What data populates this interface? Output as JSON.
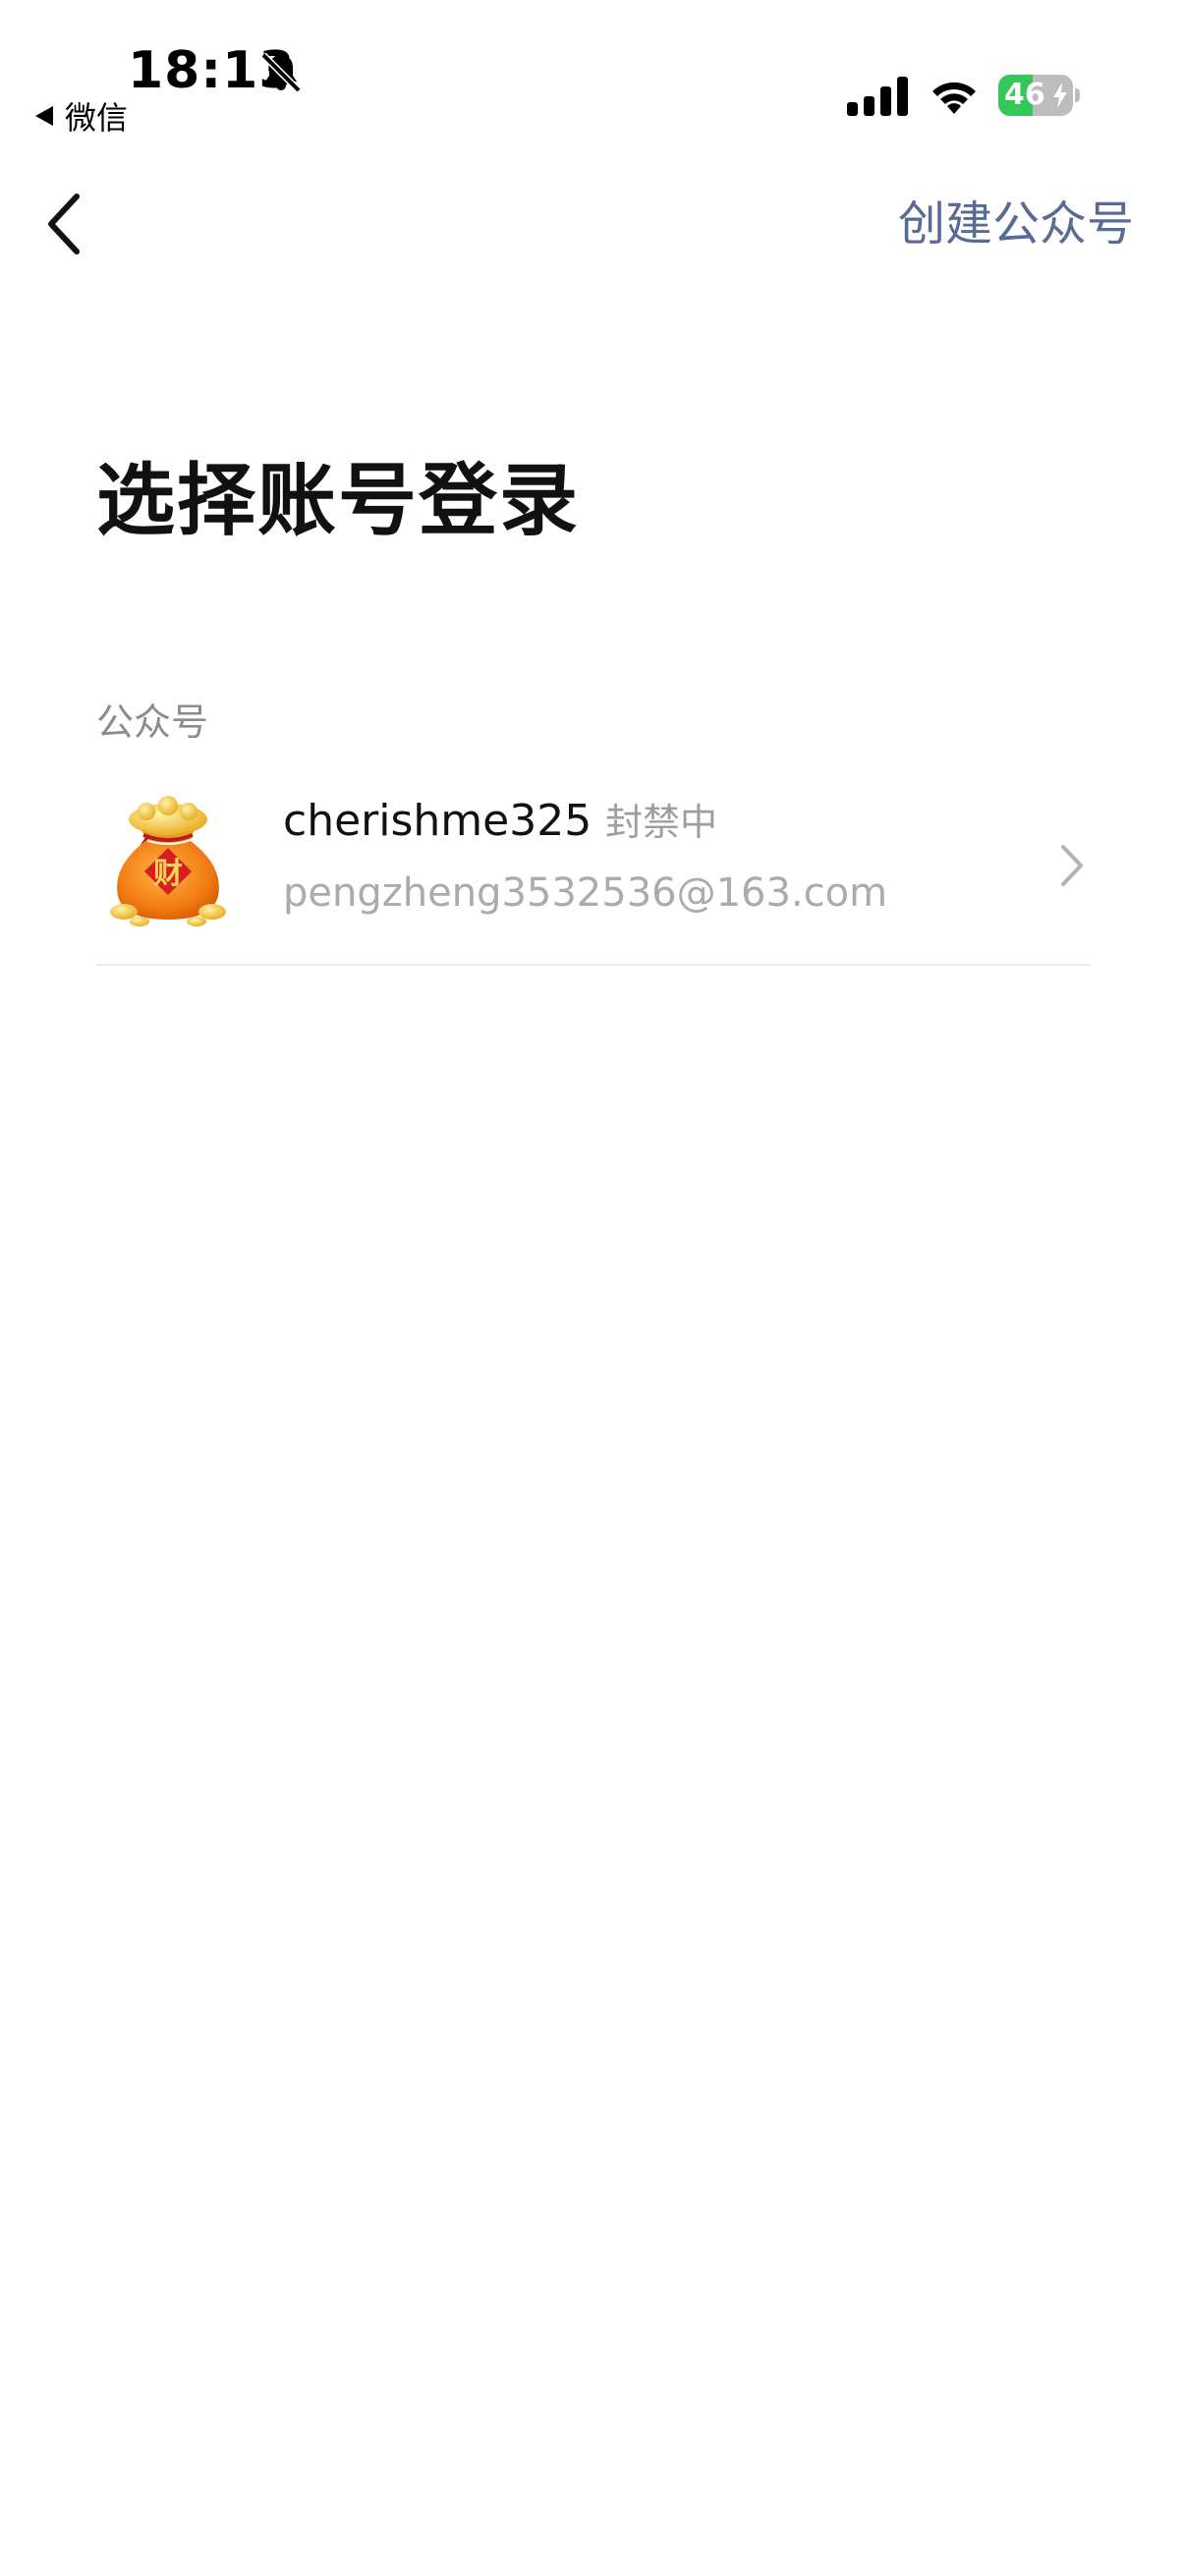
{
  "status_bar": {
    "time": "18:13",
    "back_app": "微信",
    "battery_level": "46",
    "battery_fraction": 0.46,
    "icons": [
      "bell-off-icon",
      "signal-icon",
      "wifi-icon",
      "battery-charging-icon"
    ]
  },
  "nav": {
    "back_icon": "chevron-left-icon",
    "action_label": "创建公众号",
    "action_color": "#576b95"
  },
  "page": {
    "title": "选择账号登录"
  },
  "section": {
    "label": "公众号",
    "accounts": [
      {
        "name": "cherishme325",
        "status": "封禁中",
        "email": "pengzheng3532536@163.com",
        "avatar": "money-bag-avatar",
        "avatar_text": "财"
      }
    ]
  },
  "colors": {
    "link": "#576b95",
    "secondary_text": "#9e9e9e",
    "battery_green": "#34c759"
  }
}
